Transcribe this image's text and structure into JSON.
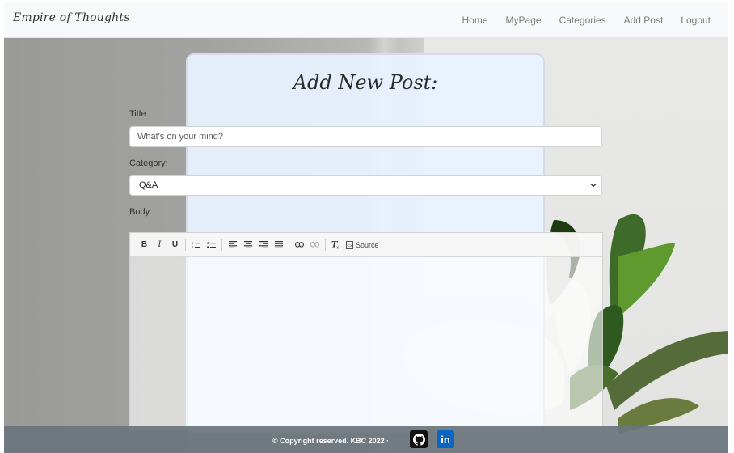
{
  "navbar": {
    "brand": "Empire of Thoughts",
    "links": [
      "Home",
      "MyPage",
      "Categories",
      "Add Post",
      "Logout"
    ]
  },
  "form": {
    "heading": "Add New Post:",
    "title_label": "Title:",
    "title_placeholder": "What's on your mind?",
    "category_label": "Category:",
    "category_value": "Q&A",
    "body_label": "Body:"
  },
  "editor": {
    "toolbar": {
      "bold": "B",
      "italic": "I",
      "underline": "U",
      "source_label": "Source"
    }
  },
  "footer": {
    "copyright": "© Copyright reserved. KBC 2022 ·",
    "icons": [
      "github-icon",
      "linkedin-icon"
    ]
  },
  "colors": {
    "navbar_bg": "#f8f9fa",
    "card_bg": "#e8f2ff",
    "footer_bg": "#6c757d",
    "linkedin": "#0a66c2"
  }
}
